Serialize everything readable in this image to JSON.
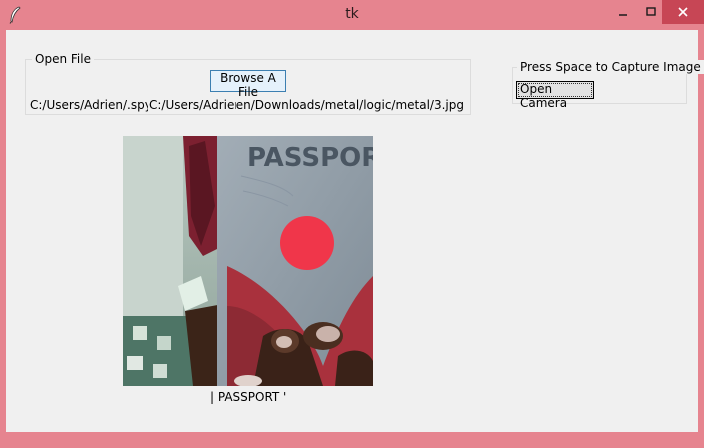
{
  "window": {
    "title": "tk",
    "icon": "feather-icon",
    "frame_color": "#e6848f",
    "close_color": "#c74655"
  },
  "open_file": {
    "label": "Open File",
    "browse_label": "Browse A File",
    "paths": [
      "C:/Users/Adrien/.spyder",
      "C:/Users/Adrien/Downloads/sign.jpg",
      "C:/Users/Adrien/Downloads/metal/logic/metal/3.jpg"
    ]
  },
  "capture": {
    "label": "Press Space to Capture Image",
    "open_camera_label": "Open Camera"
  },
  "preview": {
    "caption": "| PASSPORT '",
    "image_text": "PASSPORT"
  }
}
